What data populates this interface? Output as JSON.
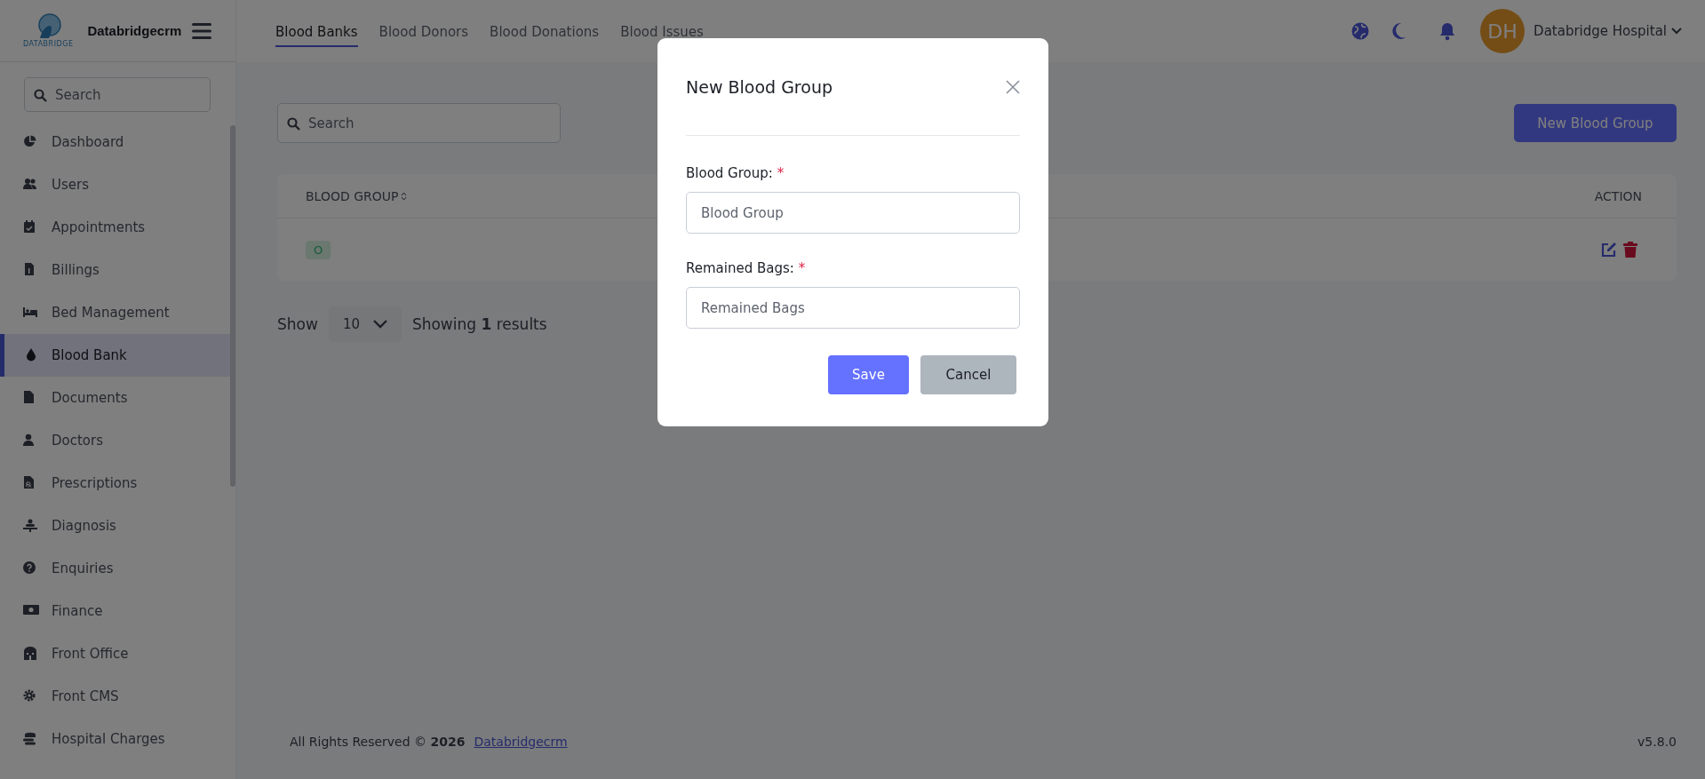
{
  "sidebar": {
    "logo_text": "DATABRIDGE",
    "brand": "Databridgecrm",
    "search": {
      "placeholder": "Search"
    },
    "items": [
      {
        "label": "Dashboard",
        "selected": false
      },
      {
        "label": "Users",
        "selected": false
      },
      {
        "label": "Appointments",
        "selected": false
      },
      {
        "label": "Billings",
        "selected": false
      },
      {
        "label": "Bed Management",
        "selected": false
      },
      {
        "label": "Blood Bank",
        "selected": true
      },
      {
        "label": "Documents",
        "selected": false
      },
      {
        "label": "Doctors",
        "selected": false
      },
      {
        "label": "Prescriptions",
        "selected": false
      },
      {
        "label": "Diagnosis",
        "selected": false
      },
      {
        "label": "Enquiries",
        "selected": false
      },
      {
        "label": "Finance",
        "selected": false
      },
      {
        "label": "Front Office",
        "selected": false
      },
      {
        "label": "Front CMS",
        "selected": false
      },
      {
        "label": "Hospital Charges",
        "selected": false
      }
    ]
  },
  "tabs": [
    {
      "label": "Blood Banks",
      "selected": true
    },
    {
      "label": "Blood Donors",
      "selected": false
    },
    {
      "label": "Blood Donations",
      "selected": false
    },
    {
      "label": "Blood Issues",
      "selected": false
    }
  ],
  "user": {
    "initials": "DH",
    "name": "Databridge Hospital"
  },
  "search": {
    "placeholder": "Search"
  },
  "new_button": "New Blood Group",
  "table": {
    "columns": [
      "BLOOD GROUP",
      "ACTION"
    ],
    "rows": [
      {
        "blood_group": "O"
      }
    ]
  },
  "pagination": {
    "show_label": "Show",
    "per_page": "10",
    "summary": "Showing **1** results"
  },
  "footer": {
    "text": "All Rights Reserved © **2026**",
    "link": "Databridgecrm",
    "version": "v5.8.0"
  },
  "modal": {
    "title": "New Blood Group",
    "fields": [
      {
        "label": "Blood Group:",
        "required_mark": "*",
        "placeholder": "Blood Group"
      },
      {
        "label": "Remained Bags:",
        "required_mark": "*",
        "placeholder": "Remained Bags"
      }
    ],
    "buttons": [
      {
        "label": "Save",
        "kind": "primary"
      },
      {
        "label": "Cancel",
        "kind": "secondary"
      }
    ]
  }
}
